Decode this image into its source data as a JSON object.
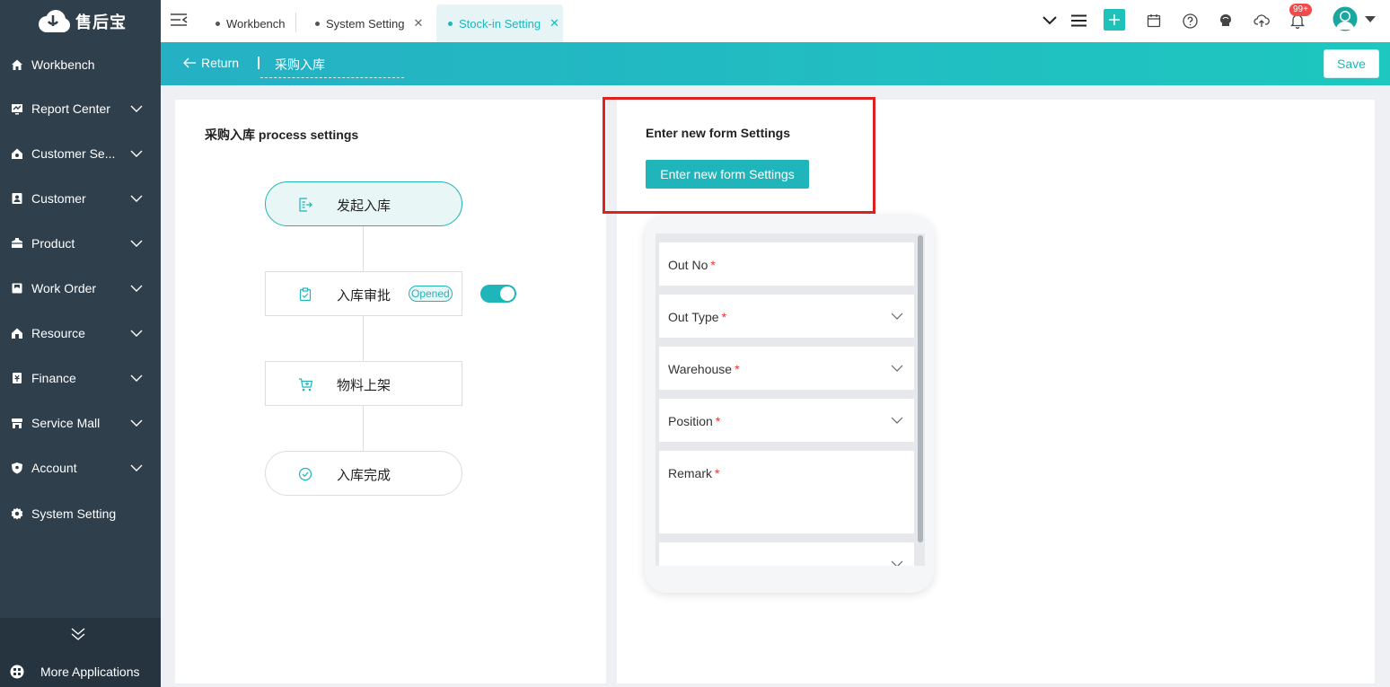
{
  "sidebar": {
    "brand": "售后宝",
    "items": [
      {
        "label": "Workbench",
        "icon": "home-icon",
        "expandable": false
      },
      {
        "label": "Report Center",
        "icon": "report-icon",
        "expandable": true
      },
      {
        "label": "Customer Se...",
        "icon": "service-icon",
        "expandable": true
      },
      {
        "label": "Customer",
        "icon": "customer-icon",
        "expandable": true
      },
      {
        "label": "Product",
        "icon": "product-icon",
        "expandable": true
      },
      {
        "label": "Work Order",
        "icon": "work-order-icon",
        "expandable": true
      },
      {
        "label": "Resource",
        "icon": "resource-icon",
        "expandable": true
      },
      {
        "label": "Finance",
        "icon": "finance-icon",
        "expandable": true
      },
      {
        "label": "Service Mall",
        "icon": "mall-icon",
        "expandable": true
      },
      {
        "label": "Account",
        "icon": "shield-icon",
        "expandable": true
      },
      {
        "label": "System Setting",
        "icon": "gear-icon",
        "expandable": false
      }
    ],
    "more_apps": "More Applications"
  },
  "tabs": [
    {
      "label": "Workbench",
      "closable": false,
      "active": false
    },
    {
      "label": "System Setting",
      "closable": true,
      "active": false
    },
    {
      "label": "Stock-in Setting",
      "closable": true,
      "active": true
    }
  ],
  "topbar": {
    "notification_badge": "99+",
    "icons": [
      "chevron-down-icon",
      "menu-icon",
      "add-icon",
      "calendar-icon",
      "help-icon",
      "skin-icon",
      "cloud-upload-icon",
      "bell-icon",
      "avatar",
      "dropdown-icon"
    ]
  },
  "subheader": {
    "return_label": "Return",
    "title": "采购入库",
    "save_label": "Save"
  },
  "left_panel": {
    "title": "采购入库 process settings",
    "nodes": [
      {
        "label": "发起入库",
        "icon": "form-export-icon"
      },
      {
        "label": "入库审批",
        "icon": "clipboard-check-icon",
        "badge": "Opened",
        "toggle_on": true
      },
      {
        "label": "物料上架",
        "icon": "cart-icon"
      },
      {
        "label": "入库完成",
        "icon": "check-circle-icon"
      }
    ]
  },
  "right_panel": {
    "title": "Enter new form Settings",
    "button_label": "Enter new form Settings",
    "fields": [
      {
        "label": "Out No",
        "required": "*",
        "dropdown": false
      },
      {
        "label": "Out Type",
        "required": "*",
        "dropdown": true
      },
      {
        "label": "Warehouse",
        "required": "*",
        "dropdown": true
      },
      {
        "label": "Position",
        "required": "*",
        "dropdown": true
      },
      {
        "label": "Remark",
        "required": "*",
        "dropdown": false
      }
    ]
  },
  "colors": {
    "accent": "#1fb5ba",
    "sidebar_bg": "#2f3f4c",
    "highlight": "#dd2222"
  }
}
